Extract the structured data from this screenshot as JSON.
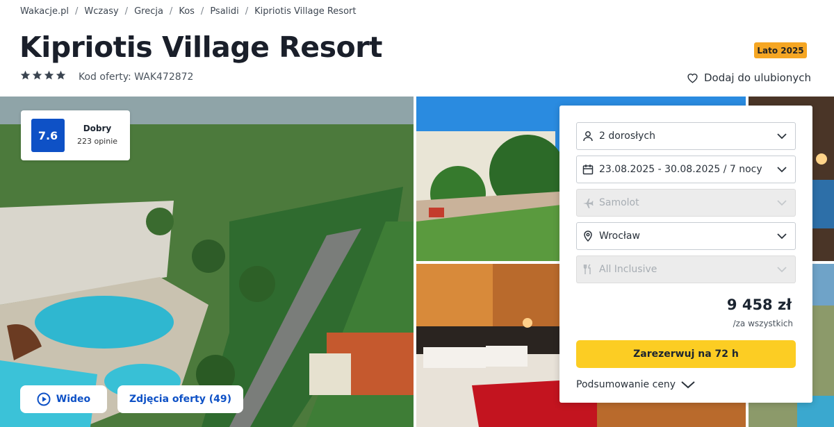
{
  "breadcrumb": [
    "Wakacje.pl",
    "Wczasy",
    "Grecja",
    "Kos",
    "Psalidi",
    "Kipriotis Village Resort"
  ],
  "hotel": {
    "name": "Kipriotis Village Resort",
    "stars": 4,
    "offer_code": "Kod oferty: WAK472872",
    "season_badge": "Lato 2025",
    "favorite_label": "Dodaj do ulubionych"
  },
  "rating": {
    "score": "7.6",
    "label": "Dobry",
    "count": "223 opinie"
  },
  "media": {
    "video_label": "Wideo",
    "photos_label": "Zdjęcia oferty (49)"
  },
  "booking": {
    "travelers": "2 dorosłych",
    "dates": "23.08.2025 - 30.08.2025 / 7 nocy",
    "transport": "Samolot",
    "departure": "Wrocław",
    "board": "All Inclusive",
    "price": "9 458 zł",
    "price_note": "/za wszystkich",
    "reserve_label": "Zarezerwuj na 72 h",
    "summary_label": "Podsumowanie ceny"
  },
  "colors": {
    "accent_blue": "#0e51c6",
    "reserve_yellow": "#fccd23",
    "badge_orange": "#f5a623",
    "star_color": "#3a4450"
  },
  "icons": [
    "star-icon",
    "heart-icon",
    "play-icon",
    "user-icon",
    "calendar-icon",
    "plane-icon",
    "location-pin-icon",
    "meal-icon",
    "chevron-down-icon"
  ]
}
